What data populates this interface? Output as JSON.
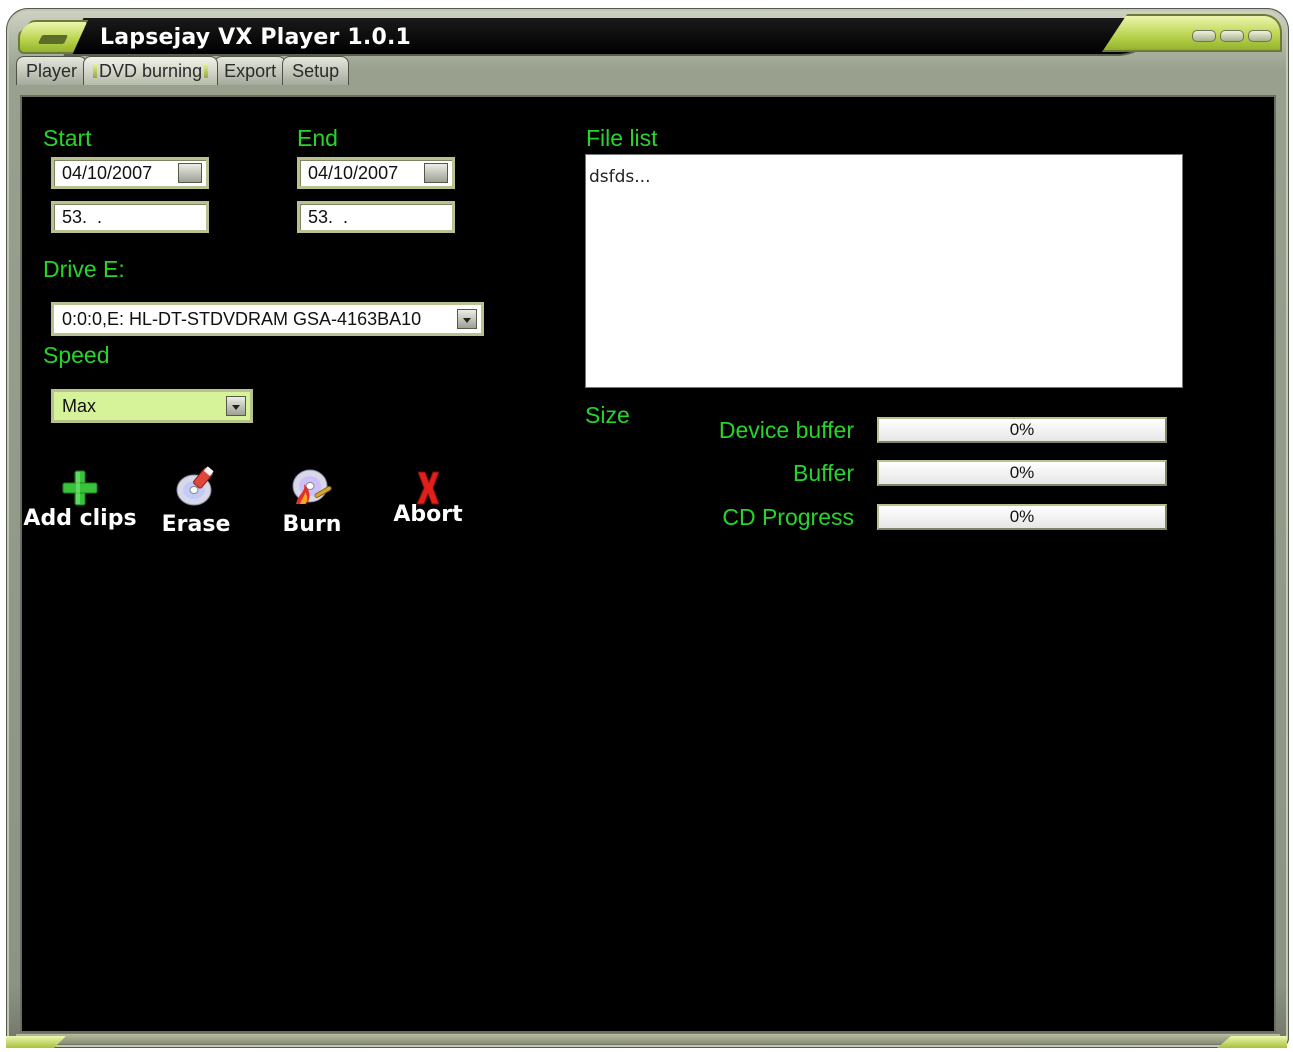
{
  "window": {
    "title": "Lapsejay VX Player 1.0.1"
  },
  "tabs": [
    {
      "label": "Player"
    },
    {
      "label": "DVD burning"
    },
    {
      "label": "Export"
    },
    {
      "label": "Setup"
    }
  ],
  "start": {
    "label": "Start",
    "date": "04/10/2007",
    "time": "53.  ."
  },
  "end": {
    "label": "End",
    "date": "04/10/2007",
    "time": "53.  ."
  },
  "drive": {
    "label": "Drive E:",
    "selected": "0:0:0,E: HL-DT-STDVDRAM GSA-4163BA10"
  },
  "speed": {
    "label": "Speed",
    "selected": "Max"
  },
  "file_list": {
    "label": "File list",
    "items": [
      "dsfds..."
    ]
  },
  "size": {
    "label": "Size"
  },
  "actions": {
    "add_clips": "Add clips",
    "erase": "Erase",
    "burn": "Burn",
    "abort": "Abort"
  },
  "progress": [
    {
      "label": "Device buffer",
      "text": "0%",
      "value": 0
    },
    {
      "label": "Buffer",
      "text": "0%",
      "value": 0
    },
    {
      "label": "CD Progress",
      "text": "0%",
      "value": 0
    }
  ],
  "colors": {
    "accent_green": "#27d52a",
    "frame_lime": "#b7d24a",
    "background": "#000000"
  }
}
